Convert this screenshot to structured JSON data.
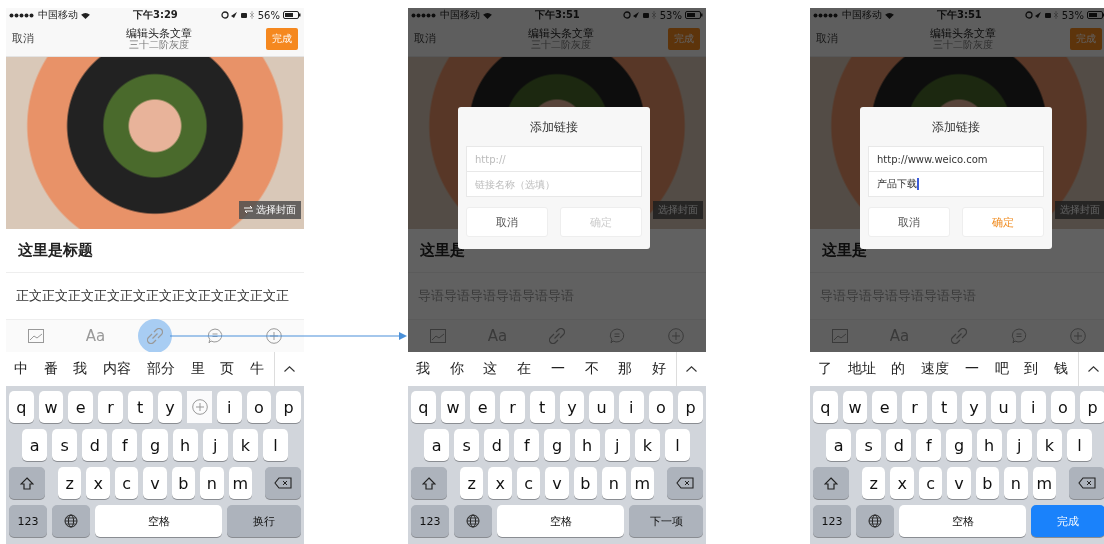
{
  "screens": [
    {
      "status": {
        "carrier": "中国移动",
        "time": "下午3:29",
        "battery": "56%"
      },
      "nav": {
        "cancel": "取消",
        "title": "编辑头条文章",
        "subtitle": "三十二阶灰度",
        "done": "完成"
      },
      "cover_button": "选择封面",
      "heading": "这里是标题",
      "body": "正文正文正文正文正文正文正文正文正文正文正",
      "tools": [
        {
          "kind": "image",
          "selected": false
        },
        {
          "kind": "text",
          "label": "Aa",
          "selected": false
        },
        {
          "kind": "link",
          "selected": true
        },
        {
          "kind": "comment",
          "selected": false
        },
        {
          "kind": "plus",
          "selected": false
        }
      ],
      "candidates": [
        "中",
        "番",
        "我",
        "内容",
        "部分",
        "里",
        "页",
        "牛"
      ],
      "keyboard": {
        "rows": [
          [
            "q",
            "w",
            "e",
            "r",
            "t",
            "y",
            "i",
            "o",
            "p"
          ],
          [
            "a",
            "s",
            "d",
            "f",
            "g",
            "h",
            "j",
            "k",
            "l"
          ],
          [
            "z",
            "x",
            "c",
            "v",
            "b",
            "n",
            "m"
          ]
        ],
        "drag_preview": true,
        "number_key": "123",
        "space": "空格",
        "return_key": "换行",
        "return_highlighted": false
      }
    },
    {
      "status": {
        "carrier": "中国移动",
        "time": "下午3:51",
        "battery": "53%"
      },
      "nav": {
        "cancel": "取消",
        "title": "编辑头条文章",
        "subtitle": "三十二阶灰度",
        "done": "完成"
      },
      "cover_button": "选择封面",
      "heading": "这里是",
      "body": "导语导语导语导语导语导语",
      "tools": [
        {
          "kind": "image",
          "selected": false
        },
        {
          "kind": "text",
          "label": "Aa",
          "selected": false
        },
        {
          "kind": "link",
          "selected": false
        },
        {
          "kind": "comment",
          "selected": false
        },
        {
          "kind": "plus",
          "selected": false
        }
      ],
      "candidates": [
        "我",
        "你",
        "这",
        "在",
        "一",
        "不",
        "那",
        "好"
      ],
      "dialog": {
        "title": "添加链接",
        "fields": [
          {
            "placeholder": "http://"
          },
          {
            "placeholder": "链接名称（选填）"
          }
        ],
        "cancel": "取消",
        "confirm": "确定",
        "confirm_disabled": true
      },
      "keyboard": {
        "rows": [
          [
            "q",
            "w",
            "e",
            "r",
            "t",
            "y",
            "u",
            "i",
            "o",
            "p"
          ],
          [
            "a",
            "s",
            "d",
            "f",
            "g",
            "h",
            "j",
            "k",
            "l"
          ],
          [
            "z",
            "x",
            "c",
            "v",
            "b",
            "n",
            "m"
          ]
        ],
        "number_key": "123",
        "space": "空格",
        "return_key": "下一项",
        "return_highlighted": false
      }
    },
    {
      "status": {
        "carrier": "中国移动",
        "time": "下午3:51",
        "battery": "53%"
      },
      "nav": {
        "cancel": "取消",
        "title": "编辑头条文章",
        "subtitle": "三十二阶灰度",
        "done": "完成"
      },
      "cover_button": "选择封面",
      "heading": "这里是",
      "body": "导语导语导语导语导语导语",
      "tools": [
        {
          "kind": "image",
          "selected": false
        },
        {
          "kind": "text",
          "label": "Aa",
          "selected": false
        },
        {
          "kind": "link",
          "selected": false
        },
        {
          "kind": "comment",
          "selected": false
        },
        {
          "kind": "plus",
          "selected": false
        }
      ],
      "candidates": [
        "了",
        "地址",
        "的",
        "速度",
        "一",
        "吧",
        "到",
        "钱"
      ],
      "dialog": {
        "title": "添加链接",
        "fields": [
          {
            "value": "http://www.weico.com",
            "focused": false
          },
          {
            "value": "产品下载",
            "focused": true
          }
        ],
        "cancel": "取消",
        "confirm": "确定",
        "confirm_disabled": false
      },
      "keyboard": {
        "rows": [
          [
            "q",
            "w",
            "e",
            "r",
            "t",
            "y",
            "u",
            "i",
            "o",
            "p"
          ],
          [
            "a",
            "s",
            "d",
            "f",
            "g",
            "h",
            "j",
            "k",
            "l"
          ],
          [
            "z",
            "x",
            "c",
            "v",
            "b",
            "n",
            "m"
          ]
        ],
        "number_key": "123",
        "space": "空格",
        "return_key": "完成",
        "return_highlighted": true
      }
    }
  ]
}
